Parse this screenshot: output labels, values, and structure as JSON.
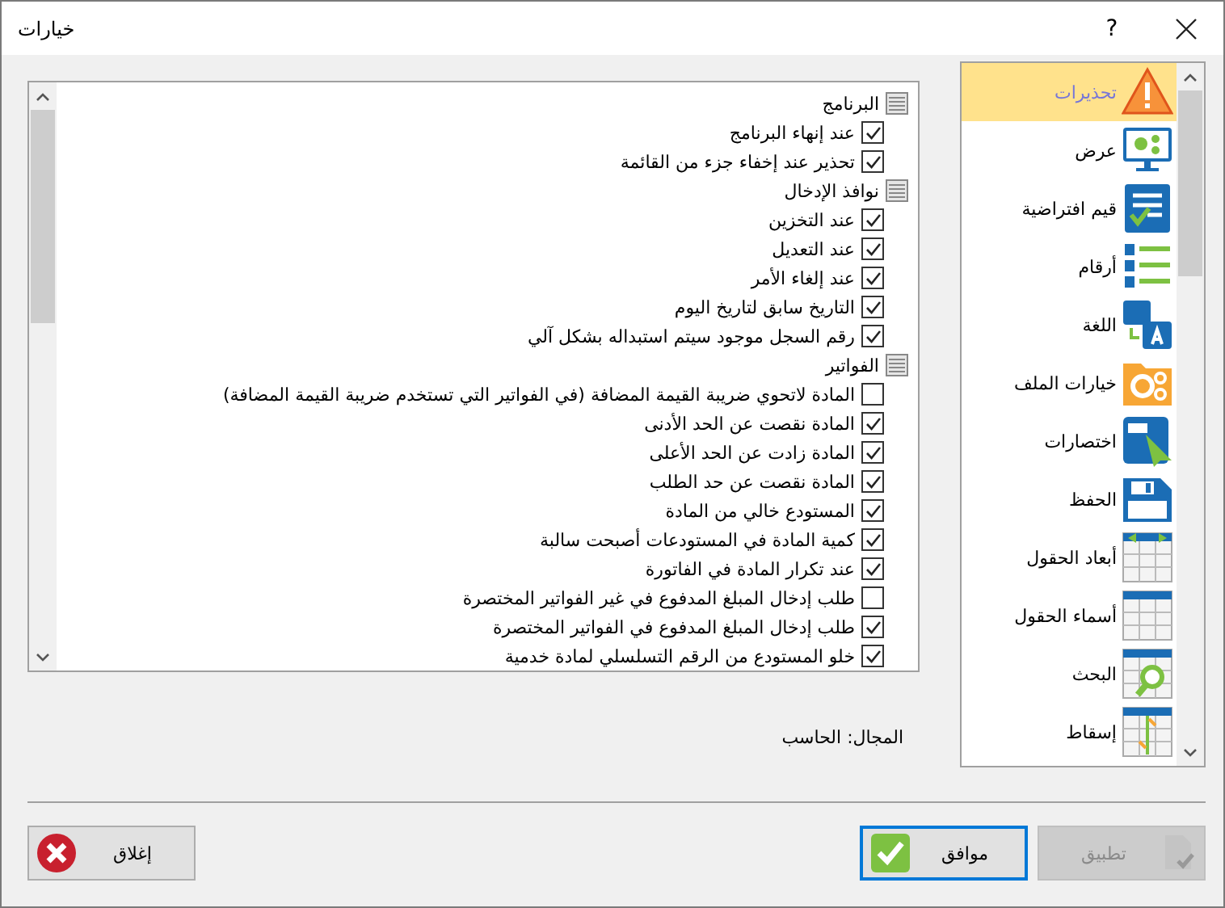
{
  "window": {
    "title": "خيارات",
    "help": "?"
  },
  "sections": [
    {
      "title": "البرنامج",
      "items": [
        {
          "label": "عند إنهاء البرنامج",
          "checked": true
        },
        {
          "label": "تحذير عند إخفاء جزء من القائمة",
          "checked": true
        }
      ]
    },
    {
      "title": "نوافذ الإدخال",
      "items": [
        {
          "label": "عند التخزين",
          "checked": true
        },
        {
          "label": "عند التعديل",
          "checked": true
        },
        {
          "label": "عند إلغاء الأمر",
          "checked": true
        },
        {
          "label": "التاريخ سابق لتاريخ اليوم",
          "checked": true
        },
        {
          "label": "رقم السجل موجود سيتم استبداله بشكل آلي",
          "checked": true
        }
      ]
    },
    {
      "title": "الفواتير",
      "items": [
        {
          "label": "المادة لاتحوي ضريبة القيمة المضافة (في الفواتير التي تستخدم ضريبة القيمة المضافة)",
          "checked": false
        },
        {
          "label": "المادة نقصت عن الحد الأدنى",
          "checked": true
        },
        {
          "label": "المادة زادت عن الحد الأعلى",
          "checked": true
        },
        {
          "label": "المادة نقصت عن حد الطلب",
          "checked": true
        },
        {
          "label": "المستودع خالي من المادة",
          "checked": true
        },
        {
          "label": "كمية المادة في المستودعات أصبحت سالبة",
          "checked": true
        },
        {
          "label": "عند تكرار المادة في الفاتورة",
          "checked": true
        },
        {
          "label": "طلب إدخال المبلغ المدفوع في غير الفواتير المختصرة",
          "checked": false
        },
        {
          "label": "طلب إدخال المبلغ المدفوع في الفواتير المختصرة",
          "checked": true
        },
        {
          "label": "خلو المستودع من الرقم التسلسلي لمادة خدمية",
          "checked": true
        }
      ]
    }
  ],
  "categories": [
    {
      "label": "تحذيرات",
      "selected": true
    },
    {
      "label": "عرض",
      "selected": false
    },
    {
      "label": "قيم افتراضية",
      "selected": false
    },
    {
      "label": "أرقام",
      "selected": false
    },
    {
      "label": "اللغة",
      "selected": false
    },
    {
      "label": "خيارات الملف",
      "selected": false
    },
    {
      "label": "اختصارات",
      "selected": false
    },
    {
      "label": "الحفظ",
      "selected": false
    },
    {
      "label": "أبعاد الحقول",
      "selected": false
    },
    {
      "label": "أسماء الحقول",
      "selected": false
    },
    {
      "label": "البحث",
      "selected": false
    },
    {
      "label": "إسقاط",
      "selected": false
    }
  ],
  "scope": "المجال: الحاسب",
  "buttons": [
    {
      "kind": "apply",
      "label": "تطبيق",
      "disabled": true
    },
    {
      "kind": "ok",
      "label": "موافق",
      "disabled": false
    },
    {
      "kind": "close",
      "label": "إغلاق",
      "disabled": false
    }
  ]
}
